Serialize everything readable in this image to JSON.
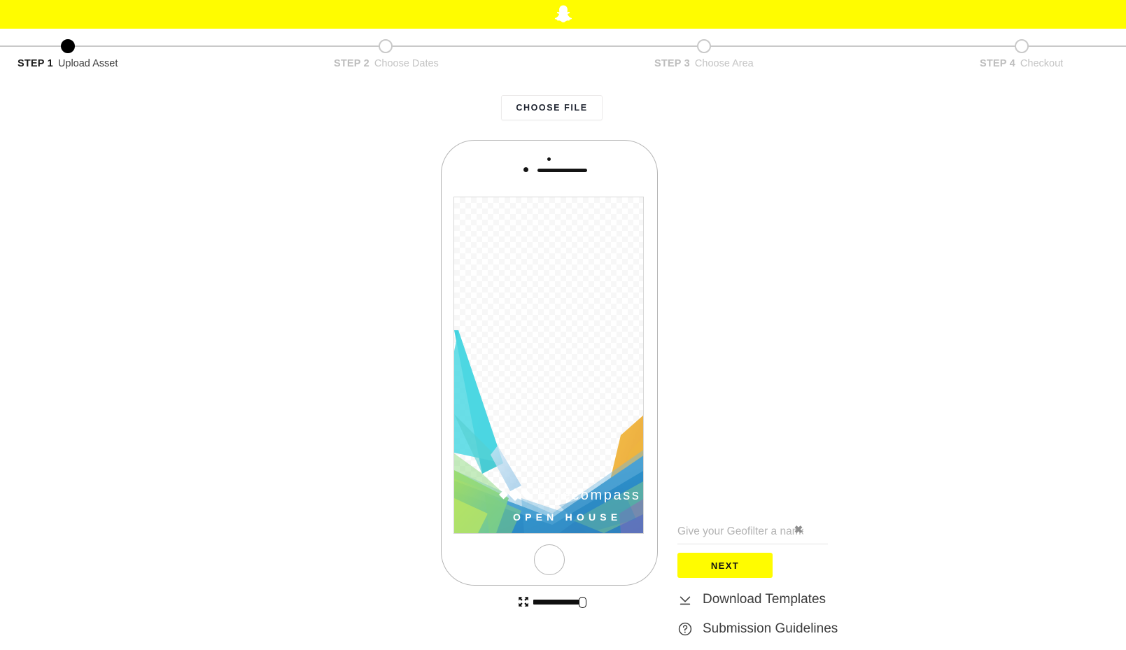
{
  "header": {
    "brand": "snapchat",
    "logo_icon": "snapchat-ghost-icon",
    "background_color": "#FFFC00"
  },
  "progress": {
    "steps": [
      {
        "num": "STEP 1",
        "label": "Upload Asset",
        "state": "active"
      },
      {
        "num": "STEP 2",
        "label": "Choose Dates",
        "state": "inactive"
      },
      {
        "num": "STEP 3",
        "label": "Choose Area",
        "state": "inactive"
      },
      {
        "num": "STEP 4",
        "label": "Checkout",
        "state": "inactive"
      }
    ],
    "active_color": "#000000",
    "inactive_color": "#c4c4c4"
  },
  "upload": {
    "choose_file_label": "CHOOSE FILE"
  },
  "preview": {
    "device": "iphone-mockup",
    "asset": {
      "brand_text": "bluecompass",
      "brand_mark": "compass-diamond-icon",
      "subtitle": "OPEN HOUSE"
    },
    "scale": {
      "icon": "resize-arrows-icon",
      "value": 100,
      "min": 0,
      "max": 100
    }
  },
  "side_panel": {
    "name_input": {
      "placeholder": "Give your Geofilter a name!",
      "value": ""
    },
    "clear_icon": "close-x-icon",
    "next_label": "NEXT",
    "links": [
      {
        "icon": "download-icon",
        "label": "Download Templates"
      },
      {
        "icon": "question-circle-icon",
        "label": "Submission Guidelines"
      }
    ],
    "next_color": "#FFFC00"
  }
}
